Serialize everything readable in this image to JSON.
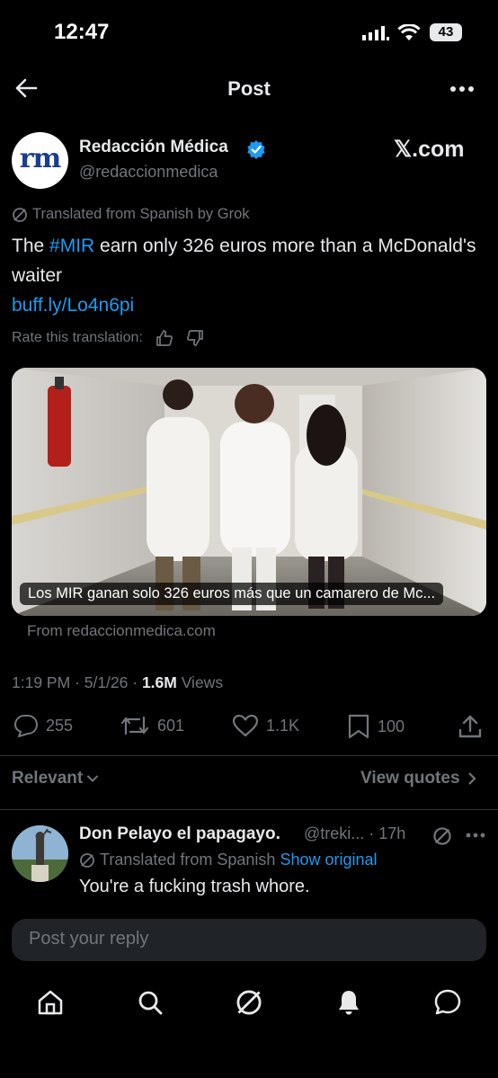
{
  "status_bar": {
    "time": "12:47",
    "battery": "43"
  },
  "header": {
    "title": "Post"
  },
  "post": {
    "author_name": "Redacción Médica",
    "author_handle": "@redaccionmedica",
    "avatar_text": "rm",
    "source_badge": "𝕏.com",
    "translated_note": "Translated from Spanish by Grok",
    "text_prefix": "The ",
    "hashtag": "#MIR",
    "text_suffix": " earn only 326 euros more than a McDonald's waiter",
    "link": "buff.ly/Lo4n6pi",
    "rate_label": "Rate this translation:",
    "card_caption": "Los MIR ganan solo 326 euros más que un camarero de Mc...",
    "card_source": "From redaccionmedica.com",
    "time": "1:19 PM · 5/1/26 · ",
    "views_count": "1.6M",
    "views_label": " Views",
    "replies": "255",
    "reposts": "601",
    "likes": "1.1K",
    "bookmarks": "100"
  },
  "sort": {
    "label": "Relevant",
    "quotes_label": "View quotes"
  },
  "reply": {
    "name": "Don Pelayo el papagayo.",
    "handle": "@treki... · 17h",
    "translated_note": "Translated from Spanish",
    "show_original": "Show original",
    "text": "You're a fucking trash whore."
  },
  "composer": {
    "placeholder": "Post your reply"
  },
  "colors": {
    "accent": "#1d9bf0",
    "muted": "#71767b",
    "background": "#000000",
    "text": "#e7e9ea"
  }
}
